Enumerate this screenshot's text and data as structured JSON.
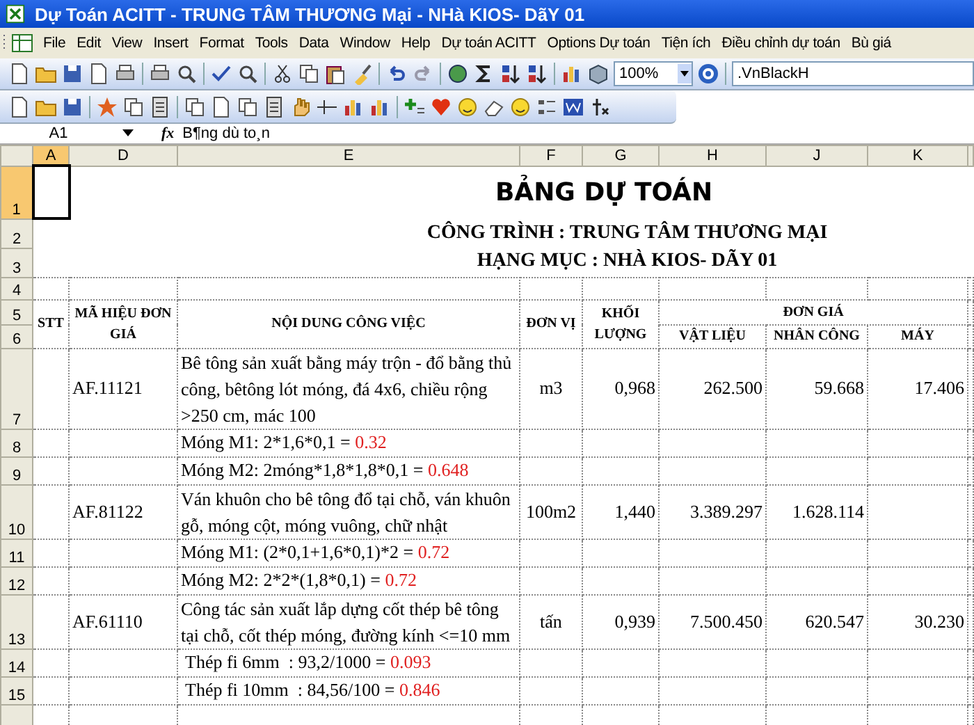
{
  "window": {
    "title": "Dự Toán ACITT - TRUNG TÂM THƯƠNG Mại - NHà KIOS- DãY 01"
  },
  "menu_bar": {
    "items": [
      "File",
      "Edit",
      "View",
      "Insert",
      "Format",
      "Tools",
      "Data",
      "Window",
      "Help",
      "Dự toán ACITT",
      "Options Dự toán",
      "Tiện ích",
      "Điều chỉnh dự toán",
      "Bù giá"
    ]
  },
  "toolbar": {
    "zoom": "100%",
    "font": ".VnBlackH"
  },
  "formula_bar": {
    "name_box": "A1",
    "fx": "fx",
    "formula": "B¶ng dù to¸n"
  },
  "columns": [
    {
      "label": "A",
      "selected": true
    },
    {
      "label": "D",
      "selected": false
    },
    {
      "label": "E",
      "selected": false
    },
    {
      "label": "F",
      "selected": false
    },
    {
      "label": "G",
      "selected": false
    },
    {
      "label": "H",
      "selected": false
    },
    {
      "label": "J",
      "selected": false
    },
    {
      "label": "K",
      "selected": false
    }
  ],
  "sheet": {
    "title": "BẢNG DỰ TOÁN",
    "project": "CÔNG TRÌNH : TRUNG TÂM THƯƠNG MẠI",
    "category": "HẠNG MỤC : NHÀ KIOS- DÃY 01",
    "header": {
      "no": "STT",
      "code": "MÃ HIỆU ĐƠN GIÁ",
      "content": "NỘI DUNG CÔNG VIỆC",
      "unit": "ĐƠN VỊ",
      "quantity": "KHỐI LƯỢNG",
      "unit_price": "ĐƠN GIÁ",
      "material": "VẬT LIỆU",
      "labor": "NHÂN CÔNG",
      "machine": "MÁY"
    },
    "row_numbers": [
      {
        "label": "1",
        "selected": true
      },
      {
        "label": "2",
        "selected": false
      },
      {
        "label": "3",
        "selected": false
      },
      {
        "label": "4",
        "selected": false
      },
      {
        "label": "5",
        "selected": false
      },
      {
        "label": "6",
        "selected": false
      }
    ],
    "rows": [
      {
        "row": "7",
        "kind": "item",
        "code": "AF.11121",
        "content": "Bê tông sản xuất bằng máy trộn - đổ bằng thủ công, bêtông lót móng, đá 4x6, chiều rộng >250 cm, mác 100",
        "unit": "m3",
        "quantity": "0,968",
        "material": "262.500",
        "labor": "59.668",
        "machine": "17.406"
      },
      {
        "row": "8",
        "kind": "detail",
        "formula": "Móng M1: 2*1,6*0,1 = ",
        "result": "0.32"
      },
      {
        "row": "9",
        "kind": "detail",
        "formula": "Móng M2: 2móng*1,8*1,8*0,1 = ",
        "result": "0.648"
      },
      {
        "row": "10",
        "kind": "item",
        "code": "AF.81122",
        "content": "Ván khuôn cho bê tông đổ tại chỗ, ván khuôn gỗ, móng cột, móng vuông, chữ nhật",
        "unit": "100m2",
        "quantity": "1,440",
        "material": "3.389.297",
        "labor": "1.628.114",
        "machine": ""
      },
      {
        "row": "11",
        "kind": "detail",
        "formula": "Móng M1: (2*0,1+1,6*0,1)*2 = ",
        "result": "0.72"
      },
      {
        "row": "12",
        "kind": "detail",
        "formula": "Móng M2: 2*2*(1,8*0,1) = ",
        "result": "0.72"
      },
      {
        "row": "13",
        "kind": "item",
        "code": "AF.61110",
        "content": "Công tác sản xuất lắp dựng cốt thép bê tông tại chỗ, cốt thép móng, đường kính <=10 mm",
        "unit": "tấn",
        "quantity": "0,939",
        "material": "7.500.450",
        "labor": "620.547",
        "machine": "30.230"
      },
      {
        "row": "14",
        "kind": "detail",
        "formula": " Thép fi 6mm  : 93,2/1000 = ",
        "result": "0.093"
      },
      {
        "row": "15",
        "kind": "detail",
        "formula": " Thép fi 10mm  : 84,56/100 = ",
        "result": "0.846"
      }
    ]
  }
}
